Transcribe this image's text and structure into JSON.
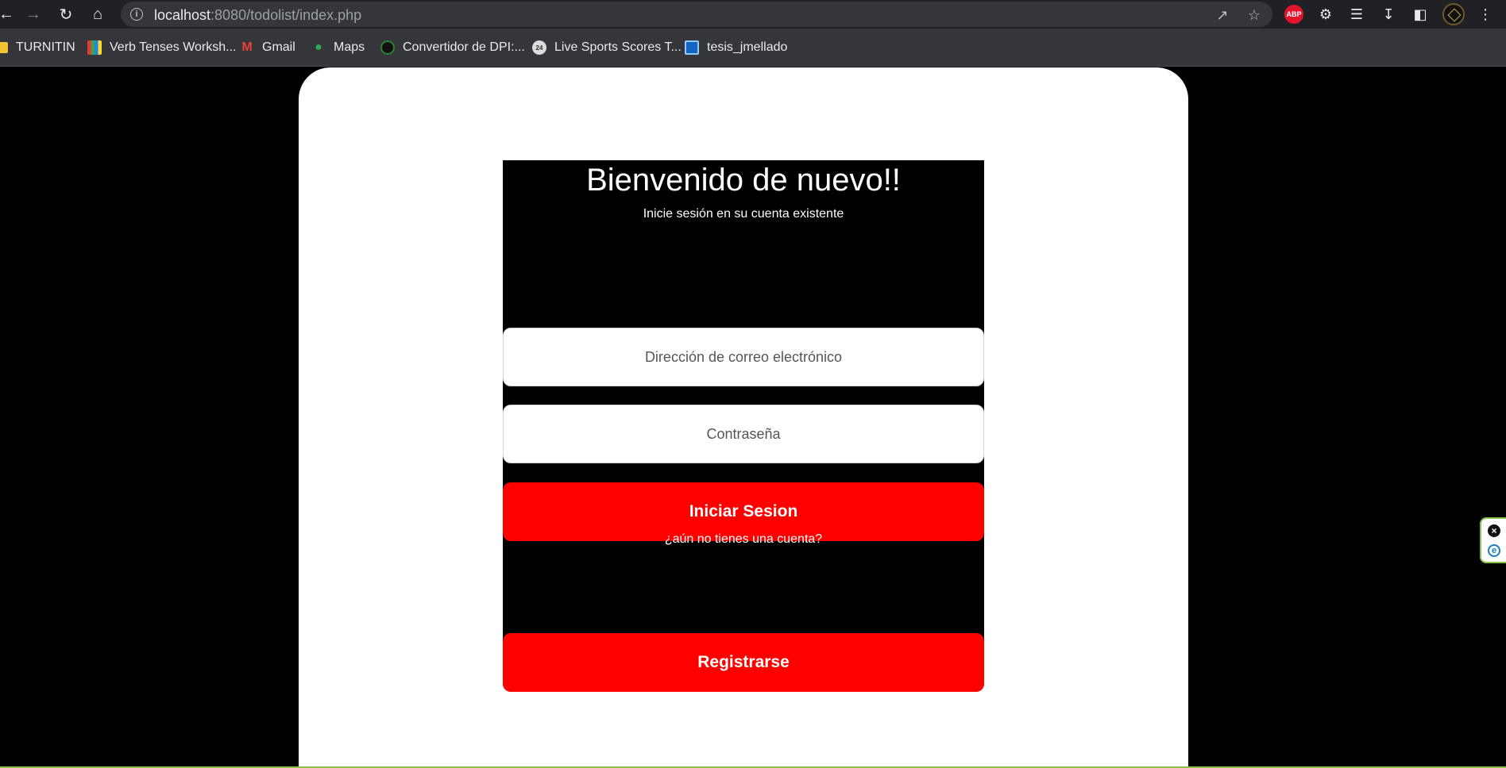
{
  "browser": {
    "url_host": "localhost",
    "url_rest": ":8080/todolist/index.php",
    "extension_badge": "ABP",
    "bookmarks": [
      {
        "label": "TURNITIN",
        "icon": "folder-icon"
      },
      {
        "label": "Verb Tenses Worksh...",
        "icon": "books-icon"
      },
      {
        "label": "Gmail",
        "icon": "gmail-icon"
      },
      {
        "label": "Maps",
        "icon": "maps-icon"
      },
      {
        "label": "Convertidor de DPI:...",
        "icon": "convertidor-icon"
      },
      {
        "label": "Live Sports Scores T...",
        "icon": "sports-icon"
      },
      {
        "label": "tesis_jmellado",
        "icon": "document-icon"
      }
    ]
  },
  "login": {
    "title": "Bienvenido de nuevo!!",
    "subtitle": "Inicie sesión en su cuenta existente",
    "email_placeholder": "Dirección de correo electrónico",
    "password_placeholder": "Contraseña",
    "login_button": "Iniciar Sesion",
    "no_account_text": "¿aún no tienes una cuenta?",
    "register_button": "Registrarse"
  },
  "colors": {
    "accent": "#ff0000",
    "page_background": "#000000",
    "card_background": "#ffffff"
  }
}
